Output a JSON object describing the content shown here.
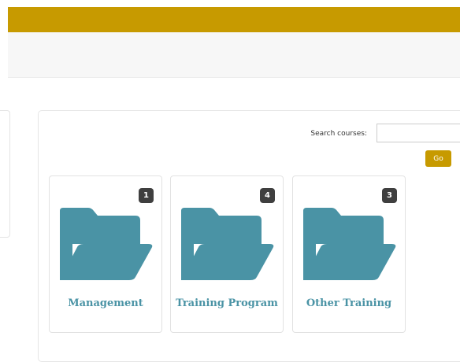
{
  "search": {
    "label": "Search courses:",
    "value": "",
    "placeholder": "",
    "go_label": "Go"
  },
  "categories": [
    {
      "title": "Management",
      "count": "1"
    },
    {
      "title": "Training Program",
      "count": "4"
    },
    {
      "title": "Other Training",
      "count": "3"
    }
  ],
  "colors": {
    "header": "#c79a00",
    "accent": "#c79a00",
    "folder": "#4a93a5",
    "badge": "#3f3f3f"
  },
  "icons": {
    "category": "folder-open-icon"
  }
}
